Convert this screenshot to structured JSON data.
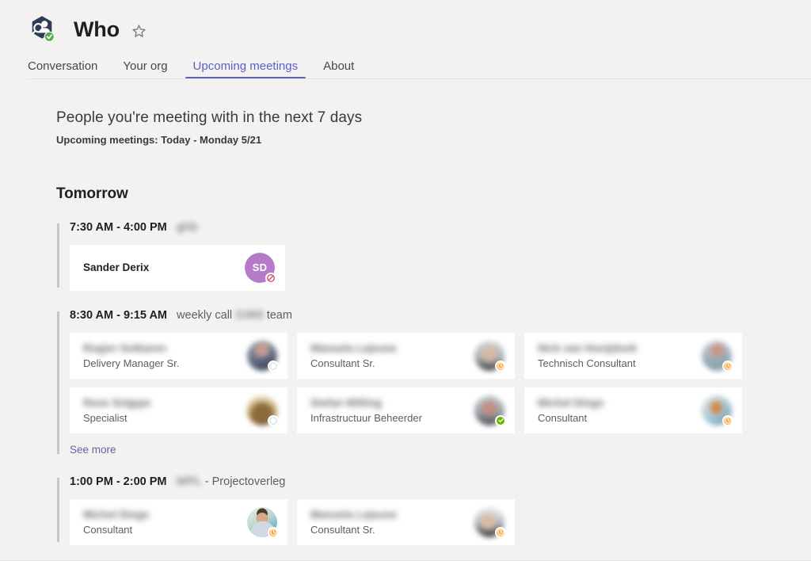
{
  "header": {
    "logo_icon": "who-app-people-search-icon",
    "logo_badge_icon": "verified-check-badge-icon",
    "title": "Who",
    "favorite_icon": "star-outline-icon"
  },
  "tabs": [
    {
      "label": "Conversation",
      "active": false
    },
    {
      "label": "Your org",
      "active": false
    },
    {
      "label": "Upcoming meetings",
      "active": true
    },
    {
      "label": "About",
      "active": false
    }
  ],
  "main": {
    "heading": "People you're meeting with in the next 7 days",
    "subheading": "Upcoming meetings: Today - Monday 5/21",
    "day_heading": "Tomorrow",
    "see_more_label": "See more"
  },
  "colors": {
    "accent": "#5b5fc7",
    "link": "#6264a7",
    "page_bg": "#f3f2f1",
    "card_bg": "#ffffff",
    "group_bar": "#c8c6c4",
    "presence_available": "#6bb700",
    "presence_away": "#ffaa44",
    "presence_dnd": "#c4314b",
    "avatar_sd": "#b57bc9"
  },
  "meetings": [
    {
      "time": "7:30 AM - 4:00 PM",
      "subject_prefix": "",
      "subject_blurred": "ghb",
      "subject_suffix": "",
      "people": [
        {
          "name": "Sander Derix",
          "name_blurred": false,
          "title": "",
          "avatar_type": "initials",
          "initials": "SD",
          "avatar_color": "#b57bc9",
          "presence": "dnd"
        }
      ],
      "see_more": false
    },
    {
      "time": "8:30 AM - 9:15 AM",
      "subject_prefix": "weekly call",
      "subject_blurred": "O365",
      "subject_suffix": "team",
      "people": [
        {
          "name": "Rogier Gelbaren",
          "name_blurred": true,
          "title": "Delivery Manager Sr.",
          "avatar_type": "photo",
          "avatar_color": "#8d8f9c",
          "presence": "none"
        },
        {
          "name": "Manuela Lejeune",
          "name_blurred": true,
          "title": "Consultant Sr.",
          "avatar_type": "photo",
          "avatar_color": "#9aa0a6",
          "presence": "away"
        },
        {
          "name": "Nick van Hooijdonk",
          "name_blurred": true,
          "title": "Technisch Consultant",
          "avatar_type": "photo",
          "avatar_color": "#a9b3ba",
          "presence": "away"
        },
        {
          "name": "Rene Snijppe",
          "name_blurred": true,
          "title": "Specialist",
          "avatar_type": "photo",
          "avatar_color": "#c3a164",
          "presence": "none"
        },
        {
          "name": "Stefan Wilting",
          "name_blurred": true,
          "title": "Infrastructuur Beheerder",
          "avatar_type": "photo",
          "avatar_color": "#9b9ea4",
          "presence": "available"
        },
        {
          "name": "Michel Dings",
          "name_blurred": true,
          "title": "Consultant",
          "avatar_type": "photo",
          "avatar_color": "#a7bcc6",
          "presence": "away"
        }
      ],
      "see_more": true
    },
    {
      "time": "1:00 PM - 2:00 PM",
      "subject_prefix": "",
      "subject_blurred": "WPL",
      "subject_suffix": "- Projectoverleg",
      "people": [
        {
          "name": "Michel Dings",
          "name_blurred": true,
          "title": "Consultant",
          "avatar_type": "photo-clear",
          "avatar_color": "#4a9fc0",
          "presence": "away"
        },
        {
          "name": "Manuela Lejeune",
          "name_blurred": true,
          "title": "Consultant Sr.",
          "avatar_type": "photo",
          "avatar_color": "#9aa0a6",
          "presence": "away"
        }
      ],
      "see_more": false
    }
  ]
}
